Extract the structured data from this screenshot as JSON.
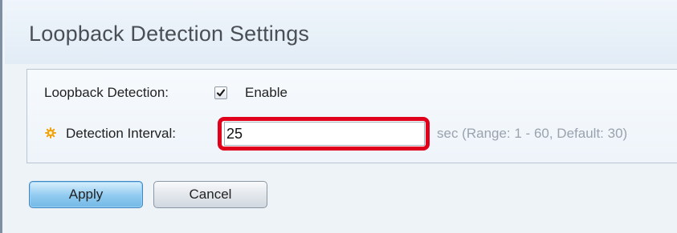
{
  "page": {
    "title": "Loopback Detection Settings"
  },
  "form": {
    "loopback_detection": {
      "label": "Loopback Detection:",
      "checked": true,
      "checkbox_label": "Enable"
    },
    "detection_interval": {
      "label": "Detection Interval:",
      "required": true,
      "value": "25",
      "hint": "sec (Range: 1 - 60, Default: 30)"
    }
  },
  "actions": {
    "apply_label": "Apply",
    "cancel_label": "Cancel"
  },
  "colors": {
    "highlight": "#e0001b",
    "required_icon": "#f2a20c",
    "apply_button": "#8fcaf0"
  }
}
